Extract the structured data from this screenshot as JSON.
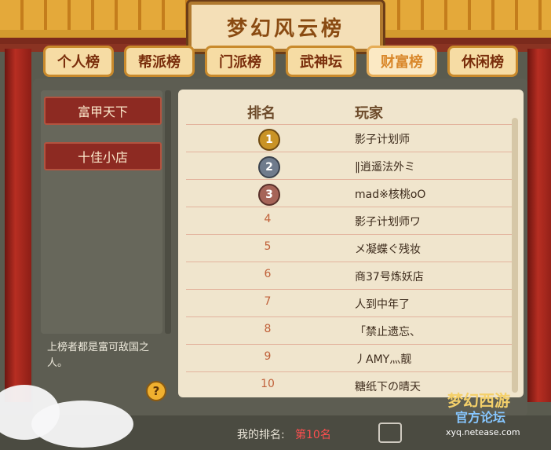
{
  "header": {
    "title": "梦幻风云榜"
  },
  "tabs": [
    {
      "label": "个人榜"
    },
    {
      "label": "帮派榜"
    },
    {
      "label": "门派榜"
    },
    {
      "label": "武神坛"
    },
    {
      "label": "财富榜"
    },
    {
      "label": "休闲榜"
    }
  ],
  "active_tab_index": 4,
  "sidebar": {
    "buttons": [
      {
        "label": "富甲天下"
      },
      {
        "label": "十佳小店"
      }
    ],
    "note": "上榜者都是富可敌国之人。"
  },
  "table": {
    "headers": {
      "rank": "排名",
      "player": "玩家"
    },
    "rows": [
      {
        "rank": "1",
        "player": "影子计划师"
      },
      {
        "rank": "2",
        "player": "‖逍遥法外ミ"
      },
      {
        "rank": "3",
        "player": "mad※核桃oO"
      },
      {
        "rank": "4",
        "player": "影子计划师ワ"
      },
      {
        "rank": "5",
        "player": "メ凝蝶ぐ残妆"
      },
      {
        "rank": "6",
        "player": "商37号炼妖店"
      },
      {
        "rank": "7",
        "player": "人到中年了"
      },
      {
        "rank": "8",
        "player": "「禁止遗忘、"
      },
      {
        "rank": "9",
        "player": "丿AMY灬靓"
      },
      {
        "rank": "10",
        "player": "糖纸下の晴天"
      }
    ]
  },
  "footer": {
    "my_rank_label": "我的排名:",
    "my_rank_value": "第10名"
  },
  "watermark": {
    "main": "梦幻西游",
    "sub1": "官方论坛",
    "sub2": "xyq.netease.com"
  },
  "icons": {
    "help": "question-icon",
    "return": "return-icon",
    "medals": [
      "gold-medal-icon",
      "silver-medal-icon",
      "bronze-medal-icon"
    ]
  },
  "colors": {
    "tab_active": "#d9872a",
    "rank_text": "#c0613a",
    "footer_value": "#ff4f4f"
  }
}
